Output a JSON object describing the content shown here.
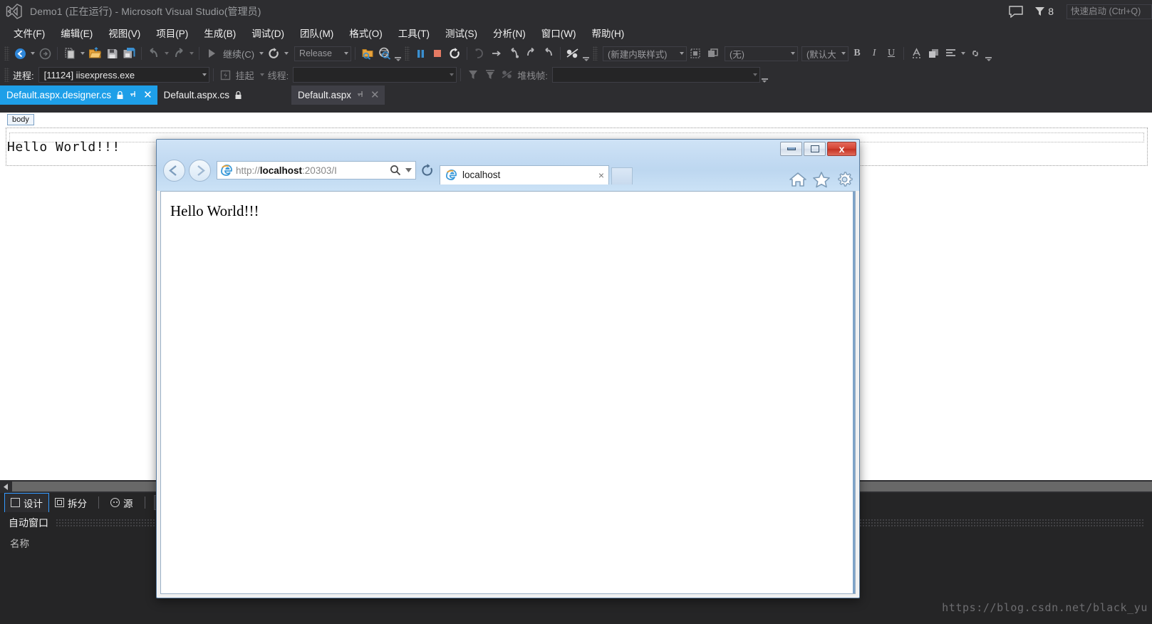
{
  "app": {
    "title": "Demo1 (正在运行) - Microsoft Visual Studio(管理员)",
    "logo_icon": "visual-studio-logo-icon",
    "feedback_icon": "feedback-speech-bubble-icon",
    "notifications_icon": "notifications-funnel-icon",
    "notifications_count": "8",
    "quick_launch_placeholder": "快速启动 (Ctrl+Q)"
  },
  "menubar": {
    "items": [
      {
        "label": "文件(F)",
        "name": "menu-file"
      },
      {
        "label": "编辑(E)",
        "name": "menu-edit"
      },
      {
        "label": "视图(V)",
        "name": "menu-view"
      },
      {
        "label": "项目(P)",
        "name": "menu-project"
      },
      {
        "label": "生成(B)",
        "name": "menu-build"
      },
      {
        "label": "调试(D)",
        "name": "menu-debug"
      },
      {
        "label": "团队(M)",
        "name": "menu-team"
      },
      {
        "label": "格式(O)",
        "name": "menu-format"
      },
      {
        "label": "工具(T)",
        "name": "menu-tools"
      },
      {
        "label": "测试(S)",
        "name": "menu-test"
      },
      {
        "label": "分析(N)",
        "name": "menu-analyze"
      },
      {
        "label": "窗口(W)",
        "name": "menu-window"
      },
      {
        "label": "帮助(H)",
        "name": "menu-help"
      }
    ]
  },
  "toolbar": {
    "navigate_back_icon": "navigate-back-icon",
    "navigate_forward_icon": "navigate-forward-icon",
    "new_item_icon": "new-item-icon",
    "open_file_icon": "open-file-folder-icon",
    "save_icon": "save-icon",
    "save_all_icon": "save-all-icon",
    "undo_icon": "undo-arrow-icon",
    "redo_icon": "redo-arrow-icon",
    "continue_icon": "continue-play-icon",
    "continue_label": "继续(C)",
    "restart_icon": "restart-icon",
    "configuration_value": "Release",
    "attach_icon": "attach-to-process-icon",
    "find_icon": "find-in-files-icon",
    "break_all_icon": "break-all-pause-icon",
    "stop_icon": "stop-debugging-icon",
    "restart_debug_icon": "restart-debugging-icon",
    "show_next_statement_icon": "show-next-statement-icon",
    "step_over_icon": "step-over-icon",
    "step_into_icon": "step-into-icon",
    "step_out_icon": "step-out-icon",
    "breakpoints_icon": "breakpoints-icon",
    "style_value": "(新建内联样式)",
    "target_rule_icon": "target-rule-icon",
    "attach_style_icon": "attach-style-sheet-icon",
    "font_value": "(无)",
    "fontsize_value": "(默认大",
    "bold_label": "B",
    "italic_label": "I",
    "underline_label": "U",
    "foreground_color_icon": "foreground-color-icon",
    "background_color_icon": "background-color-icon",
    "align_icon": "align-left-icon",
    "hyperlink_icon": "hyperlink-icon"
  },
  "debugbar": {
    "process_label": "进程:",
    "process_value": "[11124] iisexpress.exe",
    "suspend_icon": "suspend-process-icon",
    "suspend_label": "挂起",
    "thread_label": "线程:",
    "thread_value": "",
    "filter_icon": "thread-filter-icon",
    "filter_clear_icon": "clear-thread-filter-icon",
    "toggle_icon": "toggle-code-icon",
    "stackframe_label": "堆栈帧:",
    "stackframe_value": ""
  },
  "doctabs": {
    "items": [
      {
        "label": "Default.aspx.designer.cs",
        "state": "active",
        "name": "tab-default-aspx-designer-cs",
        "lock_icon": "readonly-lock-icon",
        "has_pin": true,
        "has_close": true
      },
      {
        "label": "Default.aspx.cs",
        "state": "inactive",
        "name": "tab-default-aspx-cs",
        "lock_icon": "readonly-lock-icon",
        "has_pin": false,
        "has_close": false
      },
      {
        "label": "Default.aspx",
        "state": "preview",
        "name": "tab-default-aspx",
        "lock_icon": "",
        "has_pin": true,
        "has_close": true
      }
    ]
  },
  "designer": {
    "tag_navigator": "body",
    "content_text": "Hello World!!!"
  },
  "viewtabs": {
    "items": [
      {
        "label": "设计",
        "name": "view-tab-design",
        "icon": "design-view-icon",
        "active": true
      },
      {
        "label": "拆分",
        "name": "view-tab-split",
        "icon": "split-view-icon",
        "active": false
      },
      {
        "label": "源",
        "name": "view-tab-source",
        "icon": "source-view-icon",
        "active": false
      }
    ]
  },
  "autos": {
    "title": "自动窗口",
    "column_name": "名称"
  },
  "watermark": "https://blog.csdn.net/black_yu",
  "browser": {
    "window_controls": {
      "minimize": "minimize-icon",
      "maximize": "maximize-icon",
      "close": "x"
    },
    "back_icon": "browser-back-icon",
    "forward_icon": "browser-forward-icon",
    "favicon": "internet-explorer-icon",
    "url_scheme": "http://",
    "url_host": "localhost",
    "url_rest": ":20303/I",
    "url_full": "http://localhost:20303/I",
    "search_icon": "search-magnifier-icon",
    "compat_caret_icon": "chevron-down-icon",
    "refresh_icon": "refresh-icon",
    "tab_title": "localhost",
    "tab_close": "×",
    "new_tab_icon": "new-tab-icon",
    "home_icon": "home-icon",
    "favorites_icon": "favorites-star-icon",
    "settings_icon": "settings-gear-icon",
    "page_text": "Hello World!!!"
  }
}
